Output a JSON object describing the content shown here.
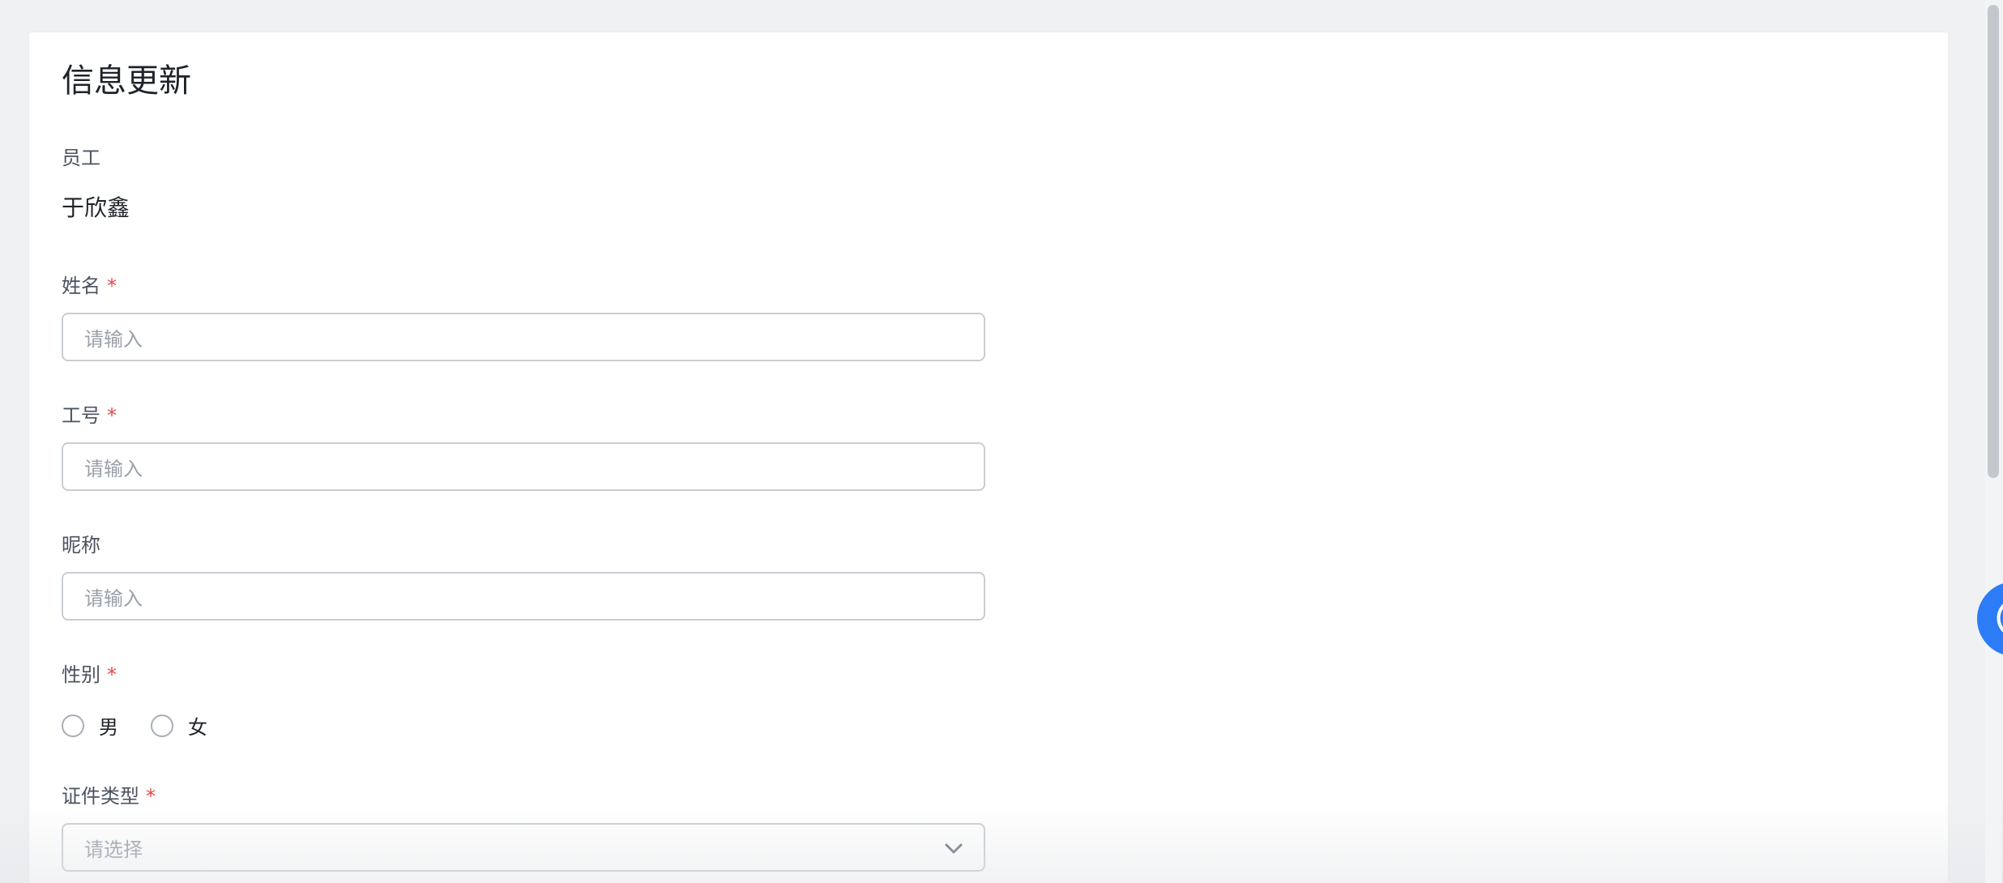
{
  "form": {
    "title": "信息更新",
    "employee": {
      "label": "员工",
      "value": "于欣鑫"
    },
    "name_field": {
      "label": "姓名",
      "required_mark": "*",
      "placeholder": "请输入"
    },
    "employee_id_field": {
      "label": "工号",
      "required_mark": "*",
      "placeholder": "请输入"
    },
    "nickname_field": {
      "label": "昵称",
      "placeholder": "请输入"
    },
    "gender_field": {
      "label": "性别",
      "required_mark": "*",
      "options": [
        "男",
        "女"
      ]
    },
    "id_type_field": {
      "label": "证件类型",
      "required_mark": "*",
      "placeholder": "请选择"
    }
  },
  "icons": {
    "select": "chevron-down-icon",
    "floating": "assistant-icon"
  },
  "colors": {
    "required": "#e5484d",
    "accent": "#2b7cf6"
  }
}
